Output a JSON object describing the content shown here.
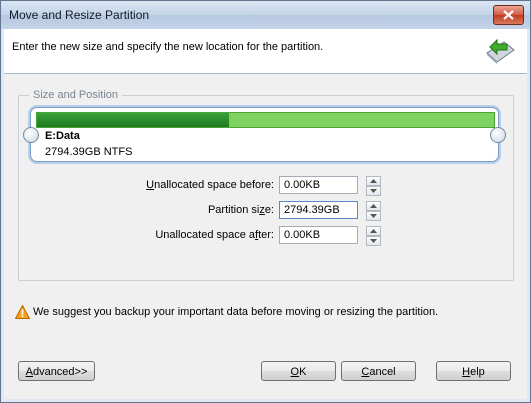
{
  "window": {
    "title": "Move and Resize Partition",
    "close_icon": "close-icon"
  },
  "header": {
    "instruction": "Enter the new size and specify the new location for the partition.",
    "icon": "move-resize-arrow-icon"
  },
  "group": {
    "legend": "Size and Position"
  },
  "partition": {
    "name": "E:Data",
    "info": "2794.39GB NTFS",
    "used_fraction": 0.42,
    "colors": {
      "used": "#1e7a1f",
      "free": "#7fd160"
    }
  },
  "fields": {
    "unallocated_before": {
      "label_pre": "",
      "label_key": "U",
      "label_post": "nallocated space before:",
      "value": "0.00KB"
    },
    "partition_size": {
      "label_pre": "Partition si",
      "label_key": "z",
      "label_post": "e:",
      "value": "2794.39GB"
    },
    "unallocated_after": {
      "label_pre": "Unallocated space a",
      "label_key": "f",
      "label_post": "ter:",
      "value": "0.00KB"
    }
  },
  "warning": {
    "icon": "warning-icon",
    "text": "We suggest you backup your important data before moving or resizing the partition."
  },
  "buttons": {
    "advanced": {
      "key": "A",
      "rest": "dvanced>>"
    },
    "ok": {
      "key": "O",
      "rest": "K"
    },
    "cancel": {
      "key": "C",
      "rest": "ancel"
    },
    "help": {
      "key": "H",
      "rest": "elp"
    }
  }
}
